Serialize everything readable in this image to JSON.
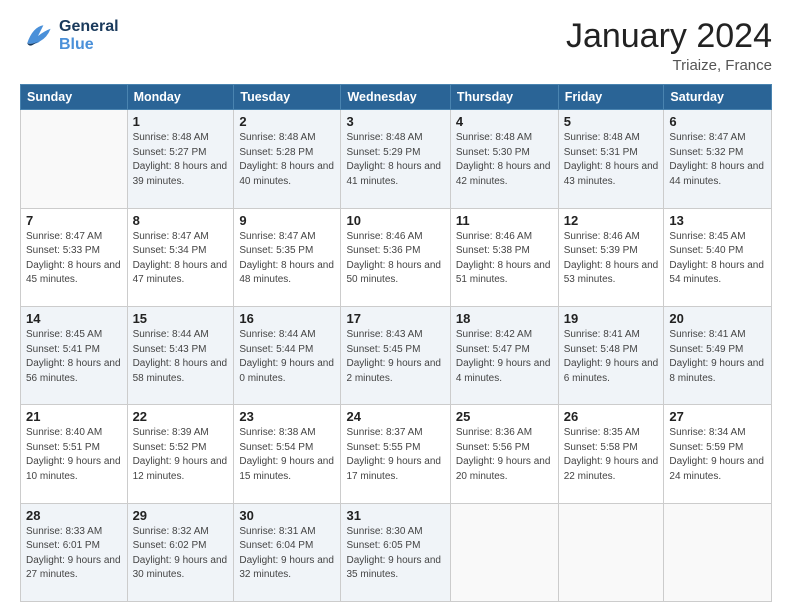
{
  "header": {
    "logo_general": "General",
    "logo_blue": "Blue",
    "title": "January 2024",
    "subtitle": "Triaize, France"
  },
  "calendar": {
    "days_of_week": [
      "Sunday",
      "Monday",
      "Tuesday",
      "Wednesday",
      "Thursday",
      "Friday",
      "Saturday"
    ],
    "weeks": [
      [
        {
          "day": "",
          "sunrise": "",
          "sunset": "",
          "daylight": ""
        },
        {
          "day": "1",
          "sunrise": "Sunrise: 8:48 AM",
          "sunset": "Sunset: 5:27 PM",
          "daylight": "Daylight: 8 hours and 39 minutes."
        },
        {
          "day": "2",
          "sunrise": "Sunrise: 8:48 AM",
          "sunset": "Sunset: 5:28 PM",
          "daylight": "Daylight: 8 hours and 40 minutes."
        },
        {
          "day": "3",
          "sunrise": "Sunrise: 8:48 AM",
          "sunset": "Sunset: 5:29 PM",
          "daylight": "Daylight: 8 hours and 41 minutes."
        },
        {
          "day": "4",
          "sunrise": "Sunrise: 8:48 AM",
          "sunset": "Sunset: 5:30 PM",
          "daylight": "Daylight: 8 hours and 42 minutes."
        },
        {
          "day": "5",
          "sunrise": "Sunrise: 8:48 AM",
          "sunset": "Sunset: 5:31 PM",
          "daylight": "Daylight: 8 hours and 43 minutes."
        },
        {
          "day": "6",
          "sunrise": "Sunrise: 8:47 AM",
          "sunset": "Sunset: 5:32 PM",
          "daylight": "Daylight: 8 hours and 44 minutes."
        }
      ],
      [
        {
          "day": "7",
          "sunrise": "Sunrise: 8:47 AM",
          "sunset": "Sunset: 5:33 PM",
          "daylight": "Daylight: 8 hours and 45 minutes."
        },
        {
          "day": "8",
          "sunrise": "Sunrise: 8:47 AM",
          "sunset": "Sunset: 5:34 PM",
          "daylight": "Daylight: 8 hours and 47 minutes."
        },
        {
          "day": "9",
          "sunrise": "Sunrise: 8:47 AM",
          "sunset": "Sunset: 5:35 PM",
          "daylight": "Daylight: 8 hours and 48 minutes."
        },
        {
          "day": "10",
          "sunrise": "Sunrise: 8:46 AM",
          "sunset": "Sunset: 5:36 PM",
          "daylight": "Daylight: 8 hours and 50 minutes."
        },
        {
          "day": "11",
          "sunrise": "Sunrise: 8:46 AM",
          "sunset": "Sunset: 5:38 PM",
          "daylight": "Daylight: 8 hours and 51 minutes."
        },
        {
          "day": "12",
          "sunrise": "Sunrise: 8:46 AM",
          "sunset": "Sunset: 5:39 PM",
          "daylight": "Daylight: 8 hours and 53 minutes."
        },
        {
          "day": "13",
          "sunrise": "Sunrise: 8:45 AM",
          "sunset": "Sunset: 5:40 PM",
          "daylight": "Daylight: 8 hours and 54 minutes."
        }
      ],
      [
        {
          "day": "14",
          "sunrise": "Sunrise: 8:45 AM",
          "sunset": "Sunset: 5:41 PM",
          "daylight": "Daylight: 8 hours and 56 minutes."
        },
        {
          "day": "15",
          "sunrise": "Sunrise: 8:44 AM",
          "sunset": "Sunset: 5:43 PM",
          "daylight": "Daylight: 8 hours and 58 minutes."
        },
        {
          "day": "16",
          "sunrise": "Sunrise: 8:44 AM",
          "sunset": "Sunset: 5:44 PM",
          "daylight": "Daylight: 9 hours and 0 minutes."
        },
        {
          "day": "17",
          "sunrise": "Sunrise: 8:43 AM",
          "sunset": "Sunset: 5:45 PM",
          "daylight": "Daylight: 9 hours and 2 minutes."
        },
        {
          "day": "18",
          "sunrise": "Sunrise: 8:42 AM",
          "sunset": "Sunset: 5:47 PM",
          "daylight": "Daylight: 9 hours and 4 minutes."
        },
        {
          "day": "19",
          "sunrise": "Sunrise: 8:41 AM",
          "sunset": "Sunset: 5:48 PM",
          "daylight": "Daylight: 9 hours and 6 minutes."
        },
        {
          "day": "20",
          "sunrise": "Sunrise: 8:41 AM",
          "sunset": "Sunset: 5:49 PM",
          "daylight": "Daylight: 9 hours and 8 minutes."
        }
      ],
      [
        {
          "day": "21",
          "sunrise": "Sunrise: 8:40 AM",
          "sunset": "Sunset: 5:51 PM",
          "daylight": "Daylight: 9 hours and 10 minutes."
        },
        {
          "day": "22",
          "sunrise": "Sunrise: 8:39 AM",
          "sunset": "Sunset: 5:52 PM",
          "daylight": "Daylight: 9 hours and 12 minutes."
        },
        {
          "day": "23",
          "sunrise": "Sunrise: 8:38 AM",
          "sunset": "Sunset: 5:54 PM",
          "daylight": "Daylight: 9 hours and 15 minutes."
        },
        {
          "day": "24",
          "sunrise": "Sunrise: 8:37 AM",
          "sunset": "Sunset: 5:55 PM",
          "daylight": "Daylight: 9 hours and 17 minutes."
        },
        {
          "day": "25",
          "sunrise": "Sunrise: 8:36 AM",
          "sunset": "Sunset: 5:56 PM",
          "daylight": "Daylight: 9 hours and 20 minutes."
        },
        {
          "day": "26",
          "sunrise": "Sunrise: 8:35 AM",
          "sunset": "Sunset: 5:58 PM",
          "daylight": "Daylight: 9 hours and 22 minutes."
        },
        {
          "day": "27",
          "sunrise": "Sunrise: 8:34 AM",
          "sunset": "Sunset: 5:59 PM",
          "daylight": "Daylight: 9 hours and 24 minutes."
        }
      ],
      [
        {
          "day": "28",
          "sunrise": "Sunrise: 8:33 AM",
          "sunset": "Sunset: 6:01 PM",
          "daylight": "Daylight: 9 hours and 27 minutes."
        },
        {
          "day": "29",
          "sunrise": "Sunrise: 8:32 AM",
          "sunset": "Sunset: 6:02 PM",
          "daylight": "Daylight: 9 hours and 30 minutes."
        },
        {
          "day": "30",
          "sunrise": "Sunrise: 8:31 AM",
          "sunset": "Sunset: 6:04 PM",
          "daylight": "Daylight: 9 hours and 32 minutes."
        },
        {
          "day": "31",
          "sunrise": "Sunrise: 8:30 AM",
          "sunset": "Sunset: 6:05 PM",
          "daylight": "Daylight: 9 hours and 35 minutes."
        },
        {
          "day": "",
          "sunrise": "",
          "sunset": "",
          "daylight": ""
        },
        {
          "day": "",
          "sunrise": "",
          "sunset": "",
          "daylight": ""
        },
        {
          "day": "",
          "sunrise": "",
          "sunset": "",
          "daylight": ""
        }
      ]
    ]
  }
}
